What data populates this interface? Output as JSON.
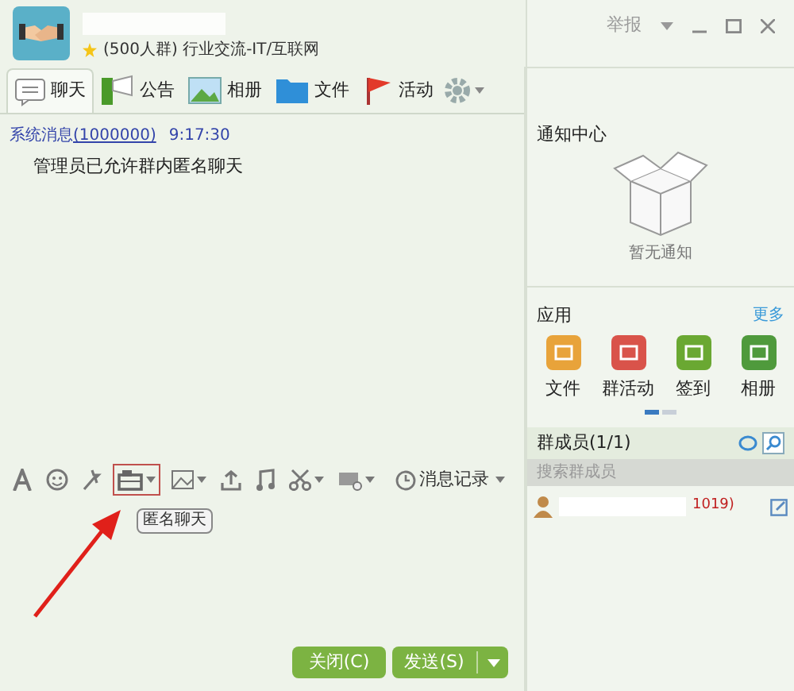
{
  "header": {
    "group_info": "(500人群) 行业交流-IT/互联网",
    "report": "举报"
  },
  "tabs": [
    {
      "label": "聊天",
      "kind": "chat",
      "selected": true
    },
    {
      "label": "公告",
      "kind": "notice",
      "selected": false
    },
    {
      "label": "相册",
      "kind": "album",
      "selected": false
    },
    {
      "label": "文件",
      "kind": "folder",
      "selected": false
    },
    {
      "label": "活动",
      "kind": "flag",
      "selected": false
    }
  ],
  "messages": [
    {
      "sender": "系统消息",
      "id": "(1000000)",
      "time": "9:17:30",
      "text": "管理员已允许群内匿名聊天"
    }
  ],
  "toolbar": {
    "history": "消息记录",
    "tooltip": "匿名聊天"
  },
  "buttons": {
    "close": "关闭(C)",
    "send": "发送(S)"
  },
  "notifications": {
    "title": "通知中心",
    "empty": "暂无通知"
  },
  "apps": {
    "title": "应用",
    "more": "更多",
    "items": [
      {
        "label": "文件",
        "color": "#e8a33a"
      },
      {
        "label": "群活动",
        "color": "#d9534a"
      },
      {
        "label": "签到",
        "color": "#6aa832"
      },
      {
        "label": "相册",
        "color": "#4f9a3c"
      }
    ]
  },
  "members": {
    "title": "群成员(1/1)",
    "search_placeholder": "搜索群成员",
    "list": [
      {
        "suffix": "1019)"
      }
    ]
  }
}
